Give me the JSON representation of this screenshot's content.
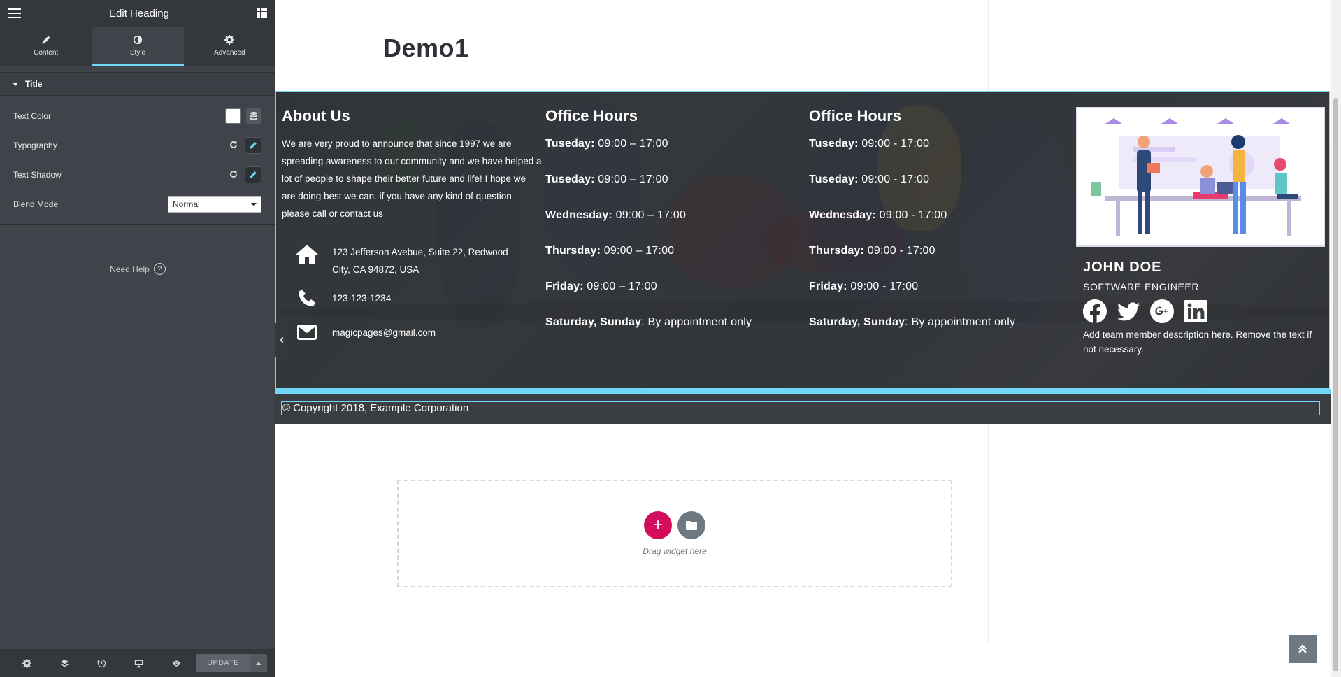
{
  "panel": {
    "title": "Edit Heading",
    "tabs": [
      {
        "label": "Content",
        "icon": "pencil-icon"
      },
      {
        "label": "Style",
        "icon": "contrast-icon",
        "active": true
      },
      {
        "label": "Advanced",
        "icon": "gear-icon"
      }
    ],
    "section_title": "Title",
    "controls": {
      "text_color_label": "Text Color",
      "text_color_value": "#ffffff",
      "typography_label": "Typography",
      "text_shadow_label": "Text Shadow",
      "blend_mode_label": "Blend Mode",
      "blend_mode_value": "Normal"
    },
    "need_help": "Need Help",
    "update_label": "UPDATE",
    "footer_icons": [
      "settings-icon",
      "layers-icon",
      "history-icon",
      "responsive-icon",
      "preview-eye-icon"
    ]
  },
  "page": {
    "title": "Demo1",
    "about": {
      "heading": "About Us",
      "text": "We are very proud to announce that since 1997 we are spreading awareness to our community and we have helped a lot of people to shape their better future and life! I hope we are doing best we can. if you have any kind of question please call or contact us",
      "address": "123 Jefferson Avebue, Suite 22, Redwood City, CA 94872, USA",
      "phone": "123-123-1234",
      "email": "magicpages@gmail.com"
    },
    "hours_1": {
      "heading": "Office Hours",
      "rows": [
        {
          "day": "Tuseday:",
          "time": " 09:00 – 17:00"
        },
        {
          "day": "Tuseday:",
          "time": " 09:00 – 17:00"
        },
        {
          "day": "Wednesday:",
          "time": " 09:00 – 17:00"
        },
        {
          "day": "Thursday:",
          "time": " 09:00 – 17:00"
        },
        {
          "day": "Friday:",
          "time": " 09:00 – 17:00"
        },
        {
          "day": "Saturday, Sunday",
          "time": ": By appointment only"
        }
      ]
    },
    "hours_2": {
      "heading": "Office Hours",
      "rows": [
        {
          "day": "Tuseday:",
          "time": " 09:00 - 17:00"
        },
        {
          "day": "Tuseday:",
          "time": " 09:00 - 17:00"
        },
        {
          "day": "Wednesday:",
          "time": " 09:00 - 17:00"
        },
        {
          "day": "Thursday:",
          "time": " 09:00 - 17:00"
        },
        {
          "day": "Friday:",
          "time": " 09:00 - 17:00"
        },
        {
          "day": "Saturday, Sunday",
          "time": ": By appointment only"
        }
      ]
    },
    "team": {
      "name": "JOHN DOE",
      "role": "SOFTWARE ENGINEER",
      "description": "Add team member description here. Remove the text if not necessary.",
      "social": [
        "facebook-icon",
        "twitter-icon",
        "google-plus-icon",
        "linkedin-icon"
      ]
    },
    "copyright": "© Copyright 2018, Example Corporation",
    "dropzone_text": "Drag widget here"
  },
  "colors": {
    "accent": "#71d7f7",
    "add_button": "#d30c5c",
    "panel_bg": "#404349",
    "panel_header": "#34383c"
  }
}
